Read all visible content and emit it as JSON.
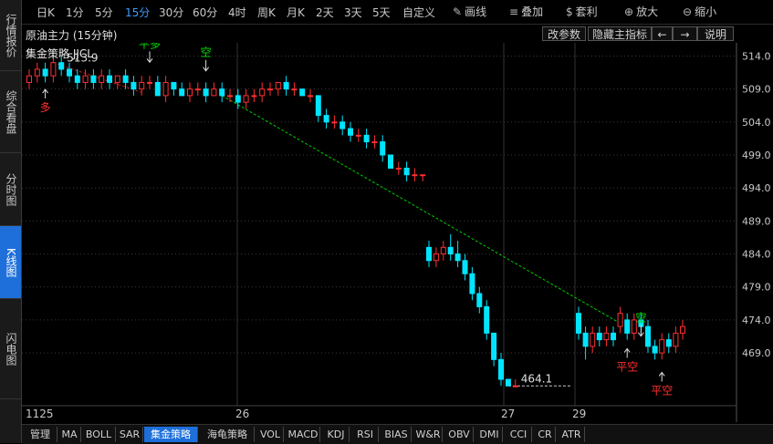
{
  "sidebar": {
    "tabs": [
      {
        "label": "行情报价"
      },
      {
        "label": "综合看盘"
      },
      {
        "label": "分时图"
      },
      {
        "label": "K线图"
      },
      {
        "label": "闪电图"
      }
    ],
    "active_tab": "K线图"
  },
  "toolbar": {
    "periods": [
      "日K",
      "1分",
      "5分",
      "15分",
      "30分",
      "60分",
      "4时",
      "周K",
      "月K",
      "2天",
      "3天",
      "5天",
      "自定义"
    ],
    "active_period": "15分",
    "tools": [
      {
        "label": "画线",
        "icon": "pen-icon"
      },
      {
        "label": "叠加",
        "icon": "stack-icon"
      },
      {
        "label": "套利",
        "icon": "money-bag-icon"
      },
      {
        "label": "放大",
        "icon": "zoom-in-icon"
      },
      {
        "label": "缩小",
        "icon": "zoom-out-icon"
      }
    ]
  },
  "titlebar": {
    "symbol": "原油主力 (15分钟)",
    "buttons": [
      "改参数",
      "隐藏主指标",
      "←",
      "→",
      "说明"
    ]
  },
  "strategy": {
    "name": "集金策略 JJCL"
  },
  "chart_data": {
    "type": "candlestick",
    "yaxis": {
      "ticks": [
        "514.0",
        "509.0",
        "504.0",
        "499.0",
        "494.0",
        "489.0",
        "484.0",
        "479.0",
        "474.0",
        "469.0"
      ],
      "ylim": [
        461,
        516
      ]
    },
    "xaxis": {
      "labels": [
        "1125",
        "26",
        "27",
        "29"
      ]
    },
    "annotations": [
      {
        "text": "多",
        "color": "#ff3030"
      },
      {
        "text": "平多",
        "color": "#00e000"
      },
      {
        "text": "空",
        "color": "#00e000"
      },
      {
        "text": "平空",
        "color": "#ff3030"
      },
      {
        "text": "空",
        "color": "#00e000"
      },
      {
        "text": "平空",
        "color": "#ff3030"
      }
    ],
    "price_labels": [
      "513.9",
      "464.1"
    ],
    "candles": [
      [
        510,
        511,
        512,
        509
      ],
      [
        511,
        512,
        513,
        510
      ],
      [
        512,
        511,
        513,
        510
      ],
      [
        511,
        513,
        514,
        510
      ],
      [
        513,
        512,
        514,
        511
      ],
      [
        512,
        511,
        513,
        510
      ],
      [
        511,
        510,
        512,
        509
      ],
      [
        510,
        511,
        512,
        509
      ],
      [
        511,
        510,
        512,
        509
      ],
      [
        510,
        511,
        512,
        509
      ],
      [
        511,
        510,
        512,
        509
      ],
      [
        510,
        511,
        511,
        509
      ],
      [
        511,
        510,
        512,
        509
      ],
      [
        510,
        509,
        511,
        508
      ],
      [
        509,
        510,
        511,
        508
      ],
      [
        510,
        510,
        511,
        509
      ],
      [
        510,
        508,
        511,
        508
      ],
      [
        508,
        510,
        511,
        507
      ],
      [
        510,
        509,
        510,
        508
      ],
      [
        509,
        508,
        510,
        508
      ],
      [
        508,
        509,
        510,
        507
      ],
      [
        509,
        509,
        510,
        508
      ],
      [
        509,
        508,
        510,
        507
      ],
      [
        508,
        509,
        510,
        508
      ],
      [
        509,
        508,
        510,
        507
      ],
      [
        508,
        508,
        509,
        507
      ],
      [
        508,
        507,
        509,
        506
      ],
      [
        507,
        508,
        509,
        506
      ],
      [
        508,
        508,
        509,
        507
      ],
      [
        508,
        509,
        510,
        507
      ],
      [
        509,
        509,
        510,
        508
      ],
      [
        509,
        510,
        510,
        508
      ],
      [
        510,
        509,
        511,
        508
      ],
      [
        509,
        509,
        510,
        508
      ],
      [
        509,
        508,
        509,
        508
      ],
      [
        508,
        508,
        509,
        507
      ],
      [
        508,
        505,
        508,
        504
      ],
      [
        505,
        504,
        506,
        503
      ],
      [
        504,
        504,
        505,
        503
      ],
      [
        504,
        503,
        505,
        502
      ],
      [
        503,
        502,
        504,
        501
      ],
      [
        502,
        502,
        503,
        501
      ],
      [
        502,
        501,
        503,
        500
      ],
      [
        501,
        501,
        502,
        500
      ],
      [
        501,
        499,
        502,
        498
      ],
      [
        499,
        497,
        499,
        497
      ],
      [
        497,
        497,
        498,
        496
      ],
      [
        497,
        496,
        498,
        495
      ],
      [
        496,
        496,
        497,
        495
      ],
      [
        496,
        496,
        496,
        495
      ],
      [
        485,
        483,
        486,
        482
      ],
      [
        483,
        484,
        485,
        482
      ],
      [
        484,
        485,
        486,
        483
      ],
      [
        485,
        484,
        487,
        483
      ],
      [
        484,
        483,
        486,
        482
      ],
      [
        483,
        481,
        484,
        480
      ],
      [
        481,
        478,
        482,
        477
      ],
      [
        478,
        476,
        479,
        475
      ],
      [
        476,
        472,
        477,
        471
      ],
      [
        472,
        468,
        472,
        467
      ],
      [
        468,
        465,
        469,
        464
      ],
      [
        465,
        464,
        465,
        464
      ],
      [
        464,
        464,
        465,
        464
      ],
      [
        475,
        472,
        476,
        471
      ],
      [
        472,
        470,
        473,
        468
      ],
      [
        470,
        472,
        473,
        469
      ],
      [
        472,
        471,
        473,
        470
      ],
      [
        471,
        472,
        473,
        470
      ],
      [
        472,
        471,
        473,
        470
      ],
      [
        473,
        475,
        476,
        472
      ],
      [
        474,
        472,
        475,
        471
      ],
      [
        472,
        474,
        475,
        471
      ],
      [
        474,
        473,
        475,
        472
      ],
      [
        473,
        470,
        474,
        469
      ],
      [
        470,
        469,
        471,
        468
      ],
      [
        469,
        471,
        472,
        468
      ],
      [
        471,
        470,
        472,
        469
      ],
      [
        470,
        472,
        473,
        469
      ],
      [
        472,
        473,
        474,
        471
      ]
    ]
  },
  "bottom_tabs": {
    "items": [
      "管理",
      "MA",
      "BOLL",
      "SAR",
      "集金策略",
      "海龟策略",
      "VOL",
      "MACD",
      "KDJ",
      "RSI",
      "BIAS",
      "W&R",
      "OBV",
      "DMI",
      "CCI",
      "CR",
      "ATR"
    ],
    "active": "集金策略"
  },
  "colors": {
    "up": "#ff3030",
    "down": "#00e5ff",
    "trend": "#00cc00",
    "accent": "#1e6fd9"
  }
}
